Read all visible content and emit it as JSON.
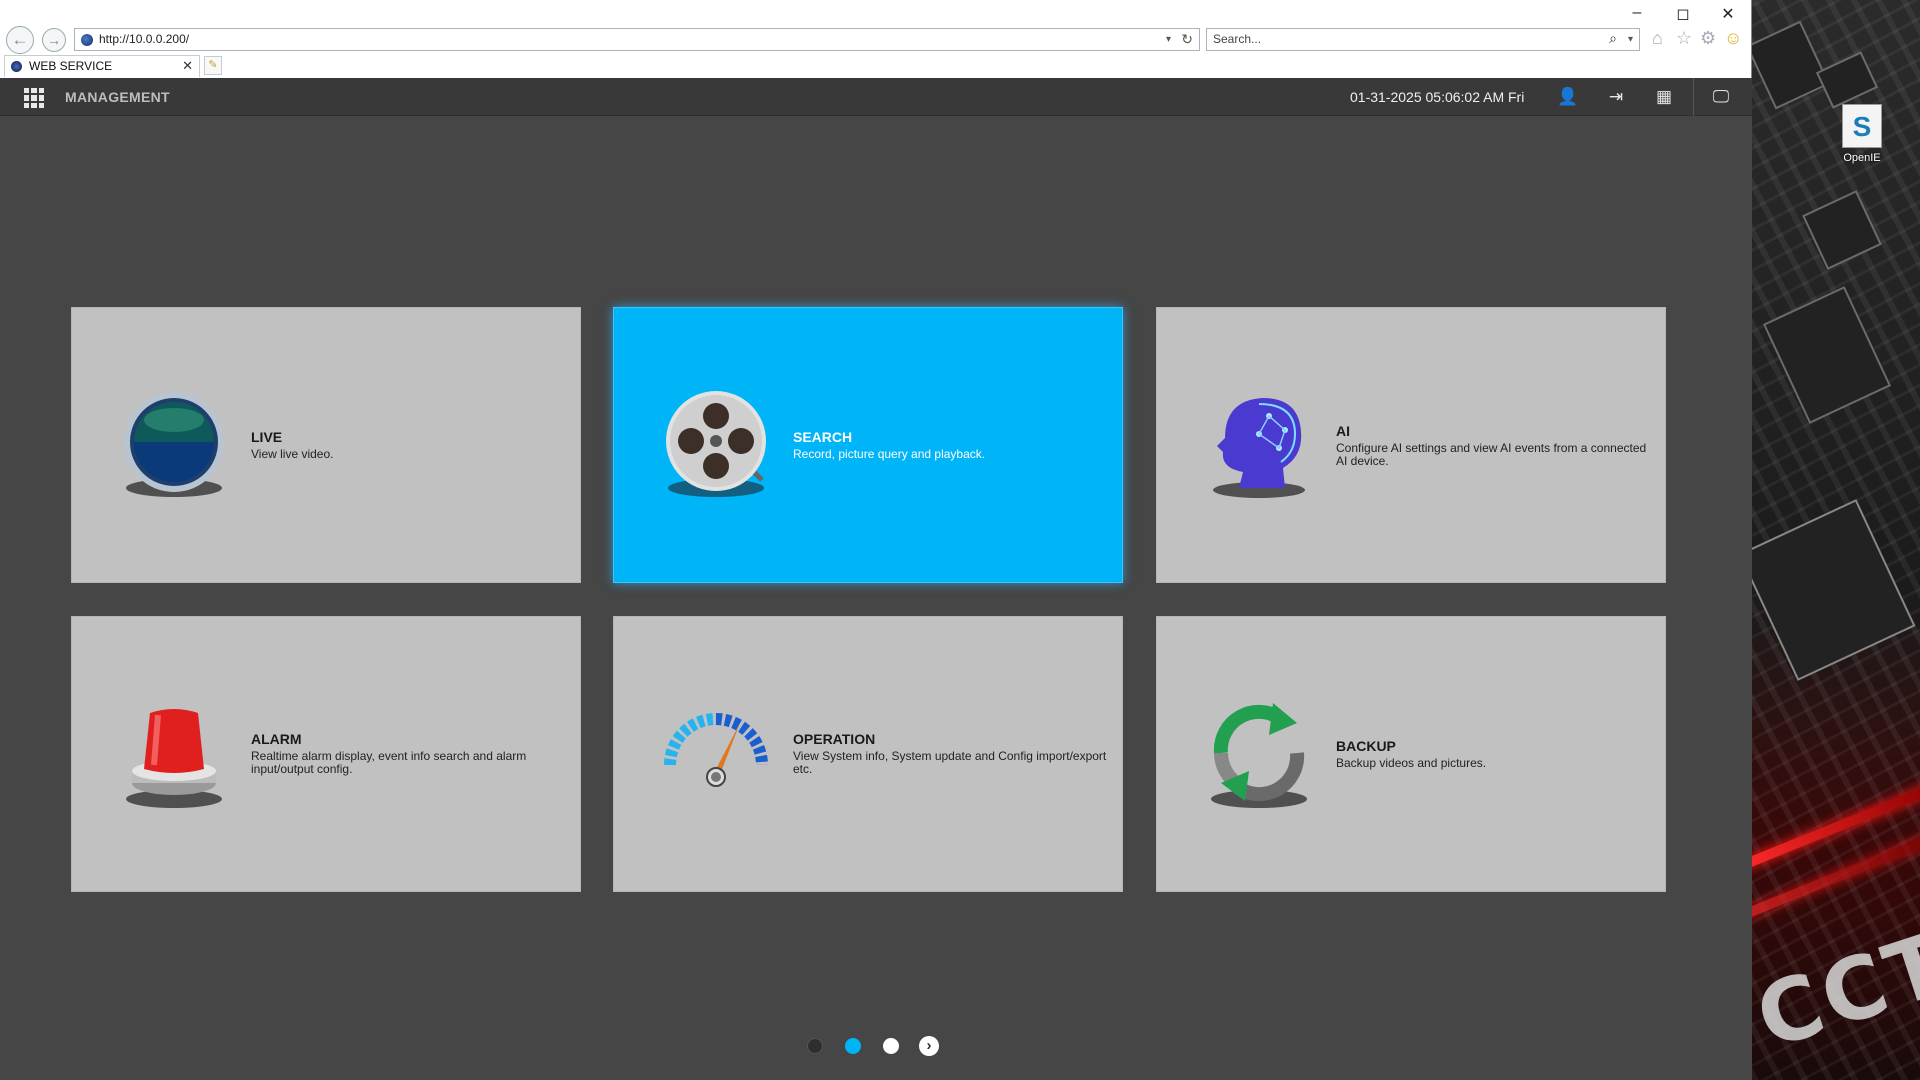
{
  "browser": {
    "url": "http://10.0.0.200/",
    "search_placeholder": "Search...",
    "tab_title": "WEB SERVICE"
  },
  "app": {
    "title": "MANAGEMENT",
    "datetime": "01-31-2025 05:06:02 AM Fri"
  },
  "cards": [
    {
      "title": "LIVE",
      "desc": "View live video.",
      "icon": "live-lens-icon"
    },
    {
      "title": "SEARCH",
      "desc": "Record, picture query and playback.",
      "icon": "film-reel-icon",
      "active": true
    },
    {
      "title": "AI",
      "desc": "Configure AI settings and view AI events from a connected AI device.",
      "icon": "ai-head-icon"
    },
    {
      "title": "ALARM",
      "desc": "Realtime alarm display, event info search and alarm input/output config.",
      "icon": "alarm-siren-icon"
    },
    {
      "title": "OPERATION",
      "desc": "View System info, System update and Config import/export etc.",
      "icon": "gauge-icon"
    },
    {
      "title": "BACKUP",
      "desc": "Backup videos and pictures.",
      "icon": "sync-arrows-icon"
    }
  ],
  "pager": {
    "pages": 3,
    "current": 2
  },
  "desktop": {
    "icon_label": "OpenIE",
    "wallpaper_text": "CCTV"
  },
  "colors": {
    "accent": "#00b4f8",
    "card": "#c1c1c1",
    "app_bg": "#464646",
    "header_bg": "#393939"
  }
}
